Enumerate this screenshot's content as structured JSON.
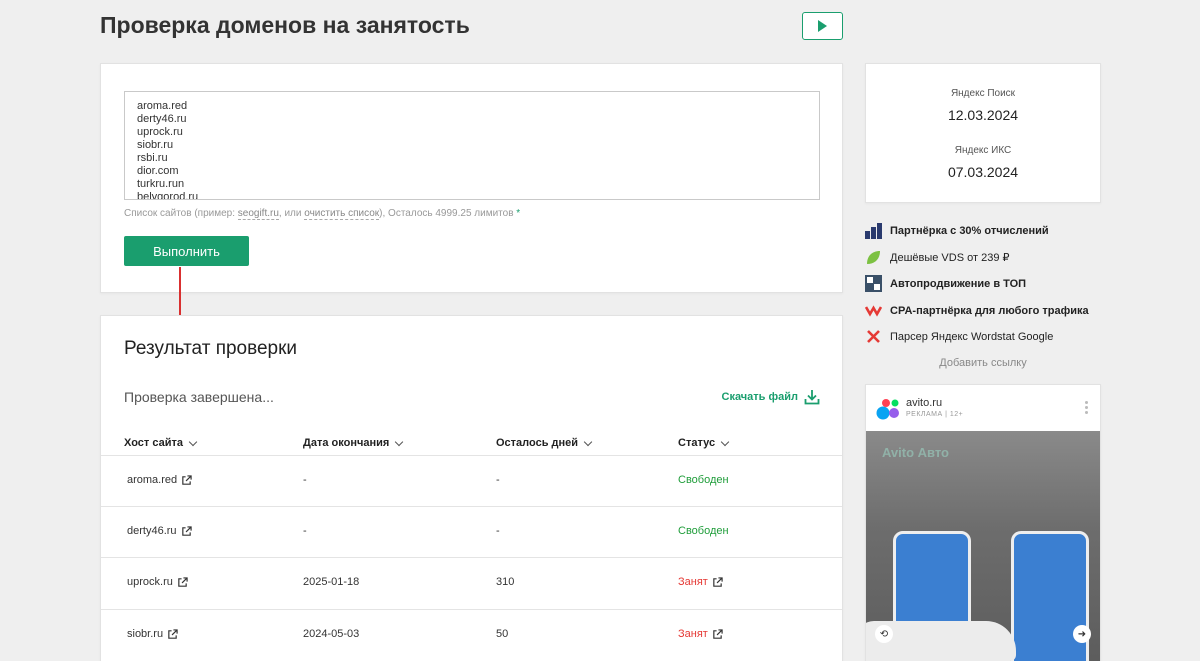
{
  "header": {
    "title": "Проверка доменов на занятость"
  },
  "input": {
    "domains": [
      "aroma.red",
      "derty46.ru",
      "uprock.ru",
      "siobr.ru",
      "rsbi.ru",
      "dior.com",
      "turkru.run",
      "belygorod.ru"
    ],
    "hint_prefix": "Список сайтов (пример: ",
    "hint_example": "seogift.ru",
    "hint_middle": ", или ",
    "hint_clear": "очистить список",
    "hint_suffix": "),  Осталось 4999.25 лимитов ",
    "hint_star": "*",
    "run_label": "Выполнить"
  },
  "results": {
    "title": "Результат проверки",
    "status_text": "Проверка завершена...",
    "download_label": "Скачать файл",
    "columns": [
      "Хост сайта",
      "Дата окончания",
      "Осталось дней",
      "Статус"
    ],
    "rows": [
      {
        "host": "aroma.red",
        "end_date": "-",
        "days_left": "-",
        "status": "Свободен",
        "state": "free"
      },
      {
        "host": "derty46.ru",
        "end_date": "-",
        "days_left": "-",
        "status": "Свободен",
        "state": "free"
      },
      {
        "host": "uprock.ru",
        "end_date": "2025-01-18",
        "days_left": "310",
        "status": "Занят",
        "state": "busy"
      },
      {
        "host": "siobr.ru",
        "end_date": "2024-05-03",
        "days_left": "50",
        "status": "Занят",
        "state": "busy"
      }
    ]
  },
  "sidebar": {
    "yandex_search_label": "Яндекс Поиск",
    "yandex_search_date": "12.03.2024",
    "yandex_iks_label": "Яндекс ИКС",
    "yandex_iks_date": "07.03.2024",
    "promos": [
      {
        "label": "Партнёрка с 30% отчислений",
        "icon": "grid-logo-icon"
      },
      {
        "label": "Дешёвые VDS от 239 ₽",
        "icon": "leaf-logo-icon"
      },
      {
        "label": "Автопродвижение в ТОП",
        "icon": "sape-logo-icon"
      },
      {
        "label": "CPA-партнёрка для любого трафика",
        "icon": "chevron-logo-icon"
      },
      {
        "label": "Парсер Яндекс Wordstat Google",
        "icon": "x-logo-icon"
      }
    ],
    "add_link": "Добавить ссылку",
    "ad": {
      "name": "avito.ru",
      "sub": "РЕКЛАМА  |  12+",
      "brand": "Avito Авто"
    }
  },
  "colors": {
    "accent": "#1a9e6e",
    "free": "#1f9d3a",
    "busy": "#e53935"
  }
}
